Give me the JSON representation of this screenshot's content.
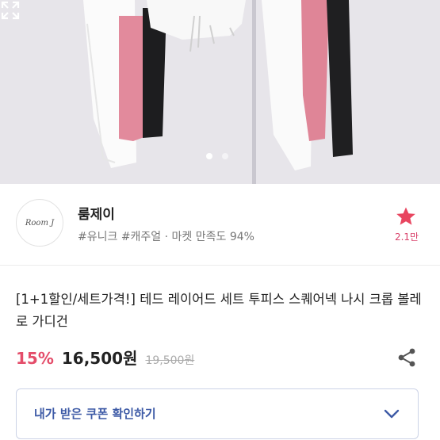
{
  "image": {
    "page_indicator": {
      "count": 2,
      "active_index": 0
    }
  },
  "seller": {
    "logo_text": "Room J",
    "name": "룸제이",
    "tags": "#유니크 #캐주얼 · 마켓 만족도 94%",
    "favorite_count": "2.1만"
  },
  "product": {
    "title": "[1+1할인/세트가격!] 테드 레이어드 세트 투피스 스퀘어넥 나시 크롭 볼레로 가디건",
    "discount": "15%",
    "price": "16,500원",
    "original_price": "19,500원"
  },
  "coupon": {
    "label": "내가 받은 쿠폰 확인하기"
  },
  "colors": {
    "accent_pink": "#e44d6a",
    "coupon_blue": "#3d5aa6",
    "star": "#e8455f"
  }
}
